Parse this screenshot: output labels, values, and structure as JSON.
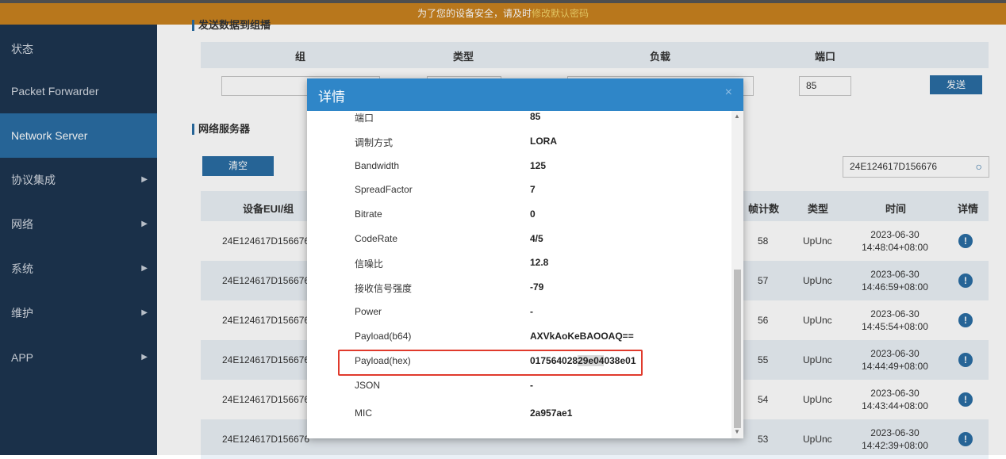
{
  "banner": {
    "text": "为了您的设备安全，请及时",
    "link": "修改默认密码"
  },
  "sidebar": {
    "items": [
      {
        "label": "状态",
        "arrow": false,
        "active": false
      },
      {
        "label": "Packet Forwarder",
        "arrow": false,
        "active": false
      },
      {
        "label": "Network Server",
        "arrow": false,
        "active": true
      },
      {
        "label": "协议集成",
        "arrow": true,
        "active": false
      },
      {
        "label": "网络",
        "arrow": true,
        "active": false
      },
      {
        "label": "系统",
        "arrow": true,
        "active": false
      },
      {
        "label": "维护",
        "arrow": true,
        "active": false
      },
      {
        "label": "APP",
        "arrow": true,
        "active": false
      }
    ]
  },
  "send_section": {
    "title": "发送数据到组播",
    "headers": [
      "组",
      "类型",
      "负载",
      "端口"
    ],
    "port_value": "85",
    "send_label": "发送"
  },
  "ns_section": {
    "title": "网络服务器",
    "clear_label": "清空",
    "search_value": "24E124617D156676",
    "headers": [
      "设备EUI/组",
      "帧计数",
      "类型",
      "时间",
      "详情"
    ],
    "rows": [
      {
        "eui": "24E124617D156676",
        "count": "58",
        "type": "UpUnc",
        "date": "2023-06-30",
        "time": "14:48:04+08:00"
      },
      {
        "eui": "24E124617D156676",
        "count": "57",
        "type": "UpUnc",
        "date": "2023-06-30",
        "time": "14:46:59+08:00"
      },
      {
        "eui": "24E124617D156676",
        "count": "56",
        "type": "UpUnc",
        "date": "2023-06-30",
        "time": "14:45:54+08:00"
      },
      {
        "eui": "24E124617D156676",
        "count": "55",
        "type": "UpUnc",
        "date": "2023-06-30",
        "time": "14:44:49+08:00"
      },
      {
        "eui": "24E124617D156676",
        "count": "54",
        "type": "UpUnc",
        "date": "2023-06-30",
        "time": "14:43:44+08:00"
      },
      {
        "eui": "24E124617D156676",
        "count": "53",
        "type": "UpUnc",
        "date": "2023-06-30",
        "time": "14:42:39+08:00"
      }
    ]
  },
  "modal": {
    "title": "详情",
    "close": "×",
    "fields": [
      {
        "key": "端口",
        "value": "85"
      },
      {
        "key": "调制方式",
        "value": "LORA"
      },
      {
        "key": "Bandwidth",
        "value": "125"
      },
      {
        "key": "SpreadFactor",
        "value": "7"
      },
      {
        "key": "Bitrate",
        "value": "0"
      },
      {
        "key": "CodeRate",
        "value": "4/5"
      },
      {
        "key": "信噪比",
        "value": "12.8"
      },
      {
        "key": "接收信号强度",
        "value": "-79"
      },
      {
        "key": "Power",
        "value": "-"
      },
      {
        "key": "Payload(b64)",
        "value": "AXVkAoKeBAOOAQ=="
      },
      {
        "key": "Payload(hex)",
        "value_a": "017564028",
        "value_b": "29e04",
        "value_c": "038e01"
      },
      {
        "key": "JSON",
        "value": "-"
      },
      {
        "key": "MIC",
        "value": "2a957ae1"
      }
    ]
  },
  "colors": {
    "sidebar": "#1d3550",
    "active": "#2a6da3",
    "banner": "#c8821f",
    "modal_header": "#2f86c8",
    "highlight": "#e03a2c"
  }
}
